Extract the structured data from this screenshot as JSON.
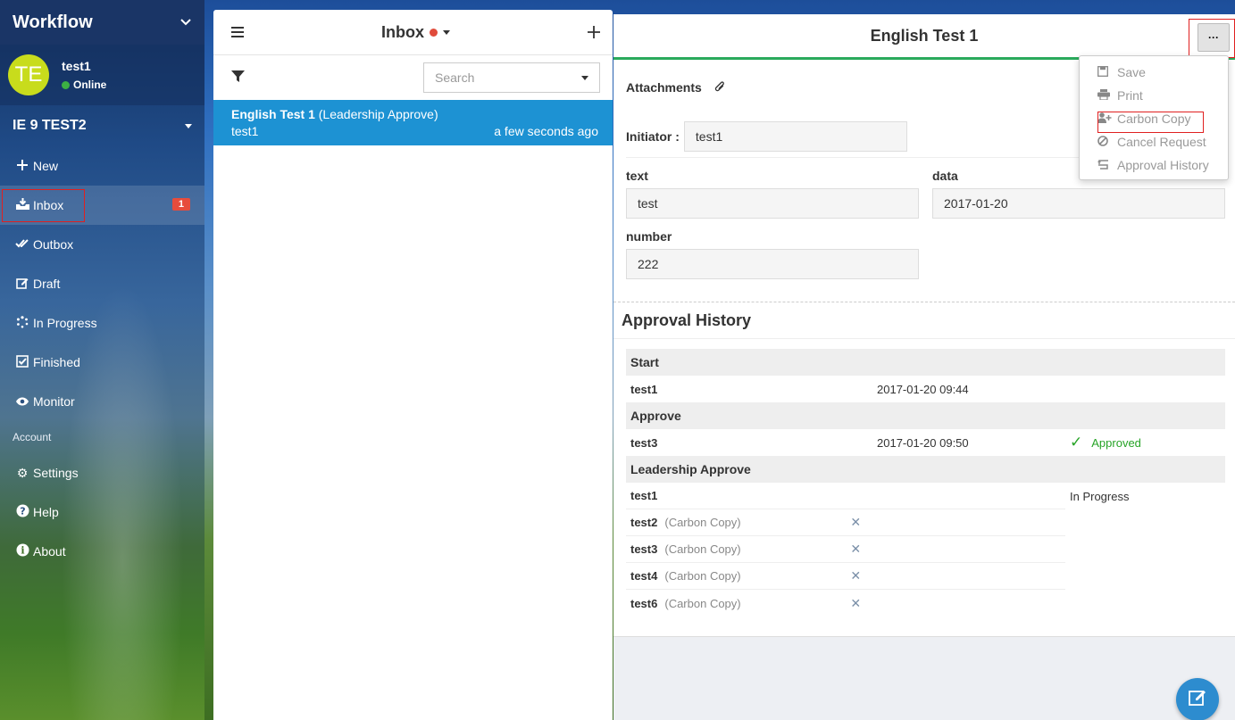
{
  "sidebar": {
    "title": "Workflow",
    "user": {
      "initials": "TE",
      "name": "test1",
      "status": "Online"
    },
    "org": "IE 9 TEST2",
    "items": [
      {
        "label": "New",
        "icon": "plus-icon"
      },
      {
        "label": "Inbox",
        "icon": "inbox-icon",
        "badge": "1"
      },
      {
        "label": "Outbox",
        "icon": "double-check-icon"
      },
      {
        "label": "Draft",
        "icon": "edit-icon"
      },
      {
        "label": "In Progress",
        "icon": "spinner-icon"
      },
      {
        "label": "Finished",
        "icon": "check-square-icon"
      },
      {
        "label": "Monitor",
        "icon": "eye-icon"
      }
    ],
    "section_account": "Account",
    "account_items": [
      {
        "label": "Settings",
        "icon": "gear-icon"
      },
      {
        "label": "Help",
        "icon": "question-icon"
      },
      {
        "label": "About",
        "icon": "info-icon"
      }
    ]
  },
  "inbox": {
    "title": "Inbox",
    "search_placeholder": "Search",
    "message": {
      "title": "English Test 1",
      "step": "(Leadership Approve)",
      "sender": "test1",
      "time": "a few seconds ago"
    }
  },
  "detail": {
    "title": "English Test 1",
    "attachments_label": "Attachments",
    "initiator_label": "Initiator :",
    "initiator_value": "test1",
    "fields": [
      {
        "label": "text",
        "value": "test"
      },
      {
        "label": "data",
        "value": "2017-01-20"
      },
      {
        "label": "number",
        "value": "222"
      }
    ],
    "history_title": "Approval History",
    "history": {
      "start": {
        "label": "Start",
        "user": "test1",
        "time": "2017-01-20 09:44"
      },
      "approve": {
        "label": "Approve",
        "user": "test3",
        "time": "2017-01-20 09:50",
        "result": "Approved"
      },
      "leadership": {
        "label": "Leadership Approve",
        "user": "test1",
        "status": "In Progress",
        "cc": [
          {
            "user": "test2",
            "tag": "(Carbon Copy)"
          },
          {
            "user": "test3",
            "tag": "(Carbon Copy)"
          },
          {
            "user": "test4",
            "tag": "(Carbon Copy)"
          },
          {
            "user": "test6",
            "tag": "(Carbon Copy)"
          }
        ]
      }
    },
    "more_label": "···"
  },
  "menu": {
    "items": [
      {
        "label": "Save",
        "icon": "save-icon"
      },
      {
        "label": "Print",
        "icon": "print-icon"
      },
      {
        "label": "Carbon Copy",
        "icon": "add-user-icon"
      },
      {
        "label": "Cancel Request",
        "icon": "ban-icon"
      },
      {
        "label": "Approval History",
        "icon": "history-icon"
      }
    ]
  },
  "colors": {
    "accent": "#1d92d3",
    "success": "#27a427",
    "badge": "#e74c3c",
    "header_bar": "#2aaa5c"
  }
}
